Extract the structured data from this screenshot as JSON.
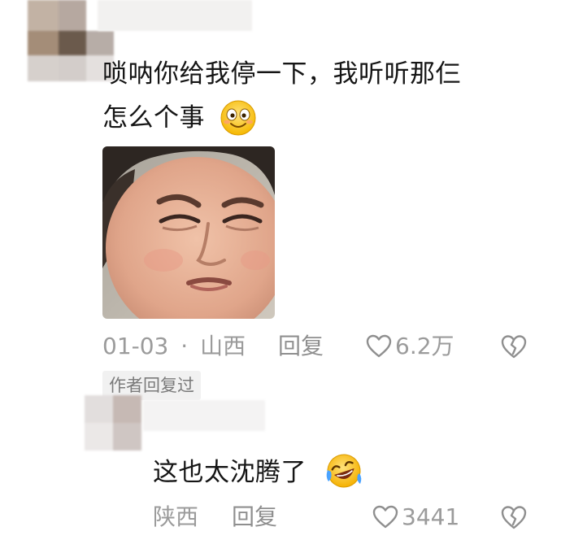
{
  "comment1": {
    "text_line1": "唢呐你给我停一下，我听听那仨",
    "text_line2": "怎么个事",
    "emoji": "smile-emoji",
    "image": "meme-face-photo",
    "date": "01-03",
    "separator": "·",
    "location": "山西",
    "reply_label": "回复",
    "like_count": "6.2万",
    "badge": "作者回复过"
  },
  "comment2": {
    "text": "这也太沈腾了",
    "emoji": "laughing-crying-emoji",
    "location": "陕西",
    "reply_label": "回复",
    "like_count": "3441"
  },
  "icons": {
    "like": "heart-outline-icon",
    "dislike": "broken-heart-icon"
  },
  "colors": {
    "meta_gray": "#9b9b9b",
    "text": "#151515",
    "badge_bg": "#f1f1f1"
  }
}
